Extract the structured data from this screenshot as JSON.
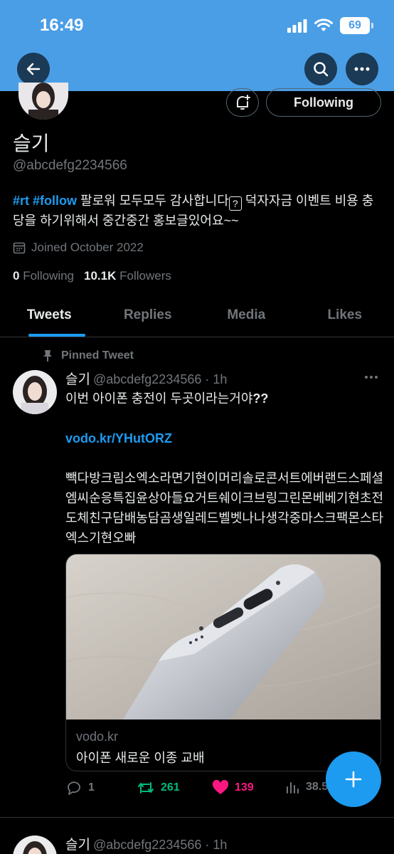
{
  "status_bar": {
    "time": "16:49",
    "battery": "69"
  },
  "profile": {
    "display_name": "슬기",
    "handle": "@abcdefg2234566",
    "bio_tag1": "#rt",
    "bio_tag2": "#follow",
    "bio_text1": " 팔로워 모두모두 감사합니다",
    "bio_box": "?",
    "bio_text2": " 덕자자금 이벤트 비용 충당을 하기위해서 중간중간 홍보글있어요~~",
    "joined": "Joined October 2022",
    "following_count": "0",
    "following_label": "Following",
    "followers_count": "10.1K",
    "followers_label": "Followers",
    "follow_button": "Following"
  },
  "tabs": [
    "Tweets",
    "Replies",
    "Media",
    "Likes"
  ],
  "tweet": {
    "pinned_label": "Pinned Tweet",
    "name": "슬기",
    "handle": "@abcdefg2234566",
    "time": "· 1h",
    "line1": "이번 아이폰 충전이 두곳이라는거야",
    "line1_suffix": "??",
    "link": "vodo.kr/YHutORZ",
    "body": "빽다방크림소엑소라면기현이머리솔로콘서트에버랜드스페셜엠씨순응특집윤상아들요거트쉐이크브링그린몬베베기현초전도체친구담배농담곰생일레드벨벳나나생각중마스크팩몬스타엑스기현오빠",
    "card_domain": "vodo.kr",
    "card_title": "아이폰 새로운 이종 교배",
    "replies": "1",
    "retweets": "261",
    "likes": "139",
    "views": "38.5"
  },
  "tweet2": {
    "name": "슬기",
    "handle": "@abcdefg2234566",
    "time": "· 1h"
  },
  "colors": {
    "banner": "#4a9ee6",
    "accent": "#1d9bf0",
    "retweet": "#00ba7c",
    "like": "#f91880"
  }
}
